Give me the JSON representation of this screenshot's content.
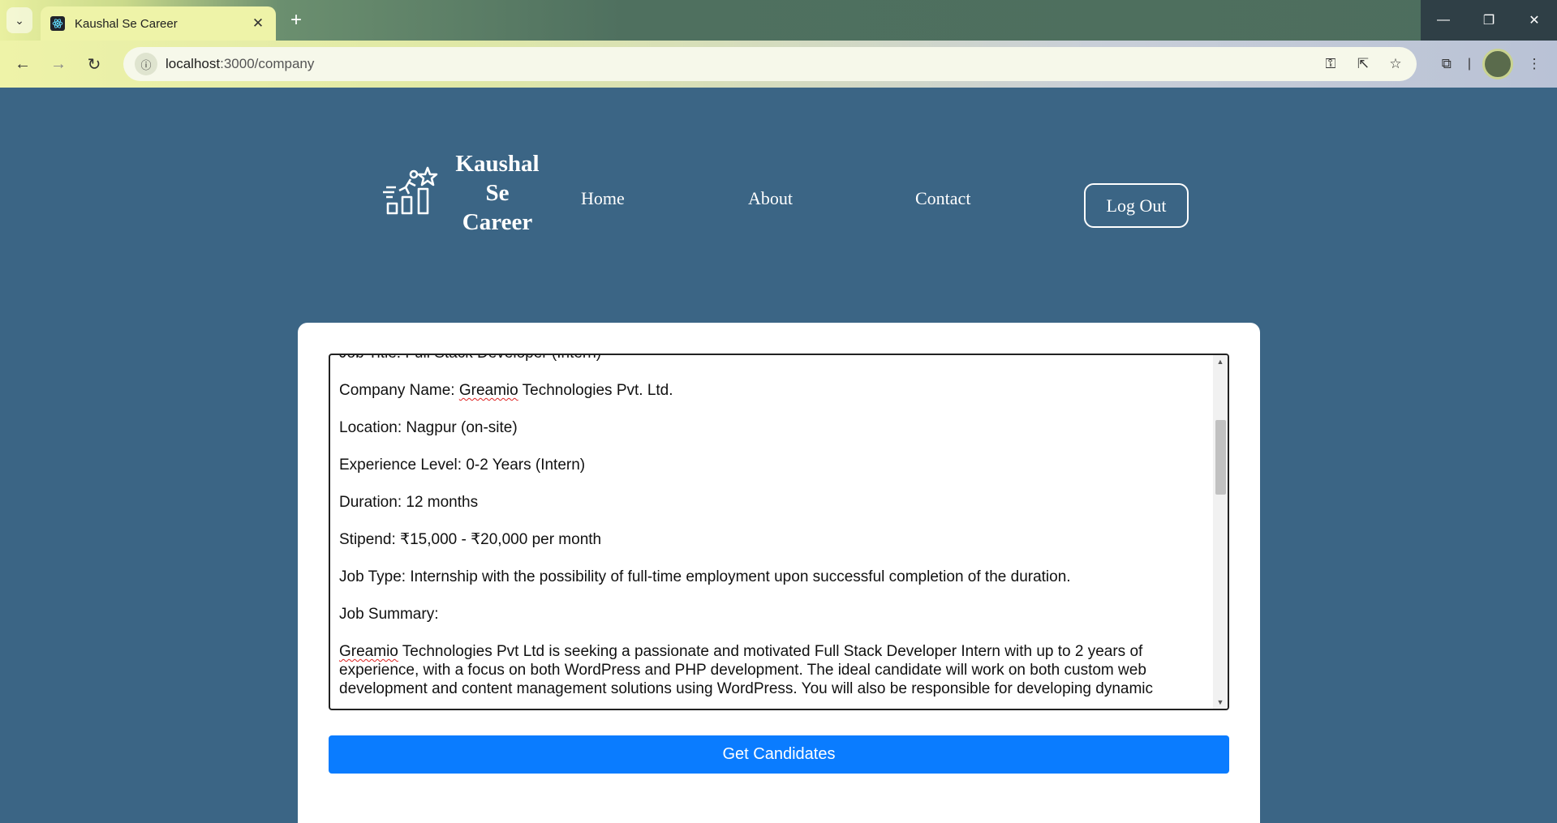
{
  "browser": {
    "tab_title": "Kaushal Se Career",
    "url_host": "localhost",
    "url_path": ":3000/company"
  },
  "header": {
    "logo_line1": "Kaushal",
    "logo_line2": "Se",
    "logo_line3": "Career",
    "nav": [
      "Home",
      "About",
      "Contact"
    ],
    "logout_label": "Log Out"
  },
  "job_description": {
    "title_line": "Job Title: Full Stack Developer (Intern)",
    "company_prefix": "Company Name: ",
    "company_word": "Greamio",
    "company_rest": " Technologies Pvt. Ltd.",
    "location": "Location: Nagpur (on-site)",
    "experience": "Experience Level: 0-2 Years (Intern)",
    "duration": "Duration: 12 months",
    "stipend": "Stipend: ₹15,000 - ₹20,000 per month",
    "job_type": "Job Type: Internship with the possibility of full-time employment upon successful completion of the duration.",
    "summary_heading": "Job Summary:",
    "summary_word": "Greamio",
    "summary_rest": " Technologies Pvt Ltd is seeking a passionate and motivated Full Stack Developer Intern with up to 2 years of experience, with a focus on both WordPress and PHP development. The ideal candidate will work on both custom web development and content management solutions using WordPress. You will also be responsible for developing dynamic"
  },
  "actions": {
    "get_candidates_label": "Get Candidates"
  },
  "colors": {
    "page_bg": "#3b6585",
    "button_blue": "#0a7cff"
  }
}
